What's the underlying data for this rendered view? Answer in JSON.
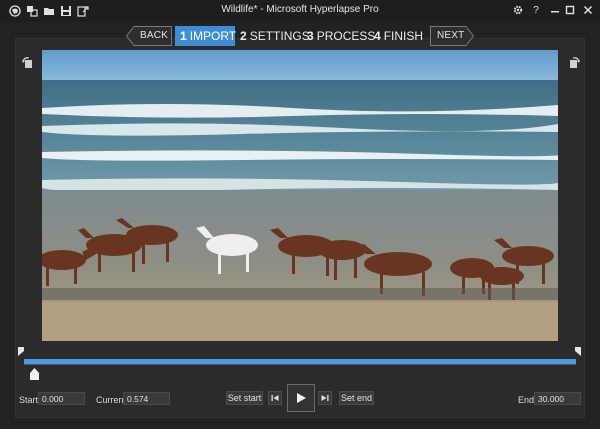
{
  "window": {
    "title": "Wildlife* - Microsoft Hyperlapse Pro",
    "quick_access": [
      "globe-icon",
      "new-project-icon",
      "open-folder-icon",
      "save-icon",
      "export-icon"
    ],
    "controls": [
      "gear-icon",
      "help-icon",
      "minimize-icon",
      "maximize-icon",
      "close-icon"
    ],
    "help_glyph": "?"
  },
  "nav": {
    "back_label": "BACK",
    "next_label": "NEXT",
    "steps": [
      {
        "num": "1",
        "label": "IMPORT",
        "active": true
      },
      {
        "num": "2",
        "label": "SETTINGS",
        "active": false
      },
      {
        "num": "3",
        "label": "PROCESS",
        "active": false
      },
      {
        "num": "4",
        "label": "FINISH",
        "active": false
      }
    ]
  },
  "preview": {
    "rotate_left": "rotate-left-icon",
    "rotate_right": "rotate-right-icon"
  },
  "timeline": {
    "start_fraction": 0.0,
    "end_fraction": 1.0,
    "current_fraction": 0.019
  },
  "controls": {
    "start_label": "Start",
    "start_value": "0.000",
    "current_label": "Current",
    "current_value": "0.574",
    "set_start_label": "Set start",
    "set_end_label": "Set end",
    "end_label": "End",
    "end_value": "30.000"
  },
  "colors": {
    "accent": "#3e8ed6",
    "timeline": "#4a9be6",
    "background": "#222222",
    "panel": "#2b2b2b"
  }
}
